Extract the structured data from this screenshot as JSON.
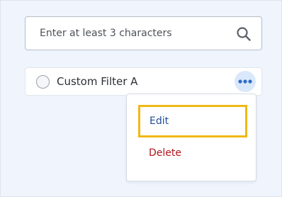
{
  "search": {
    "placeholder": "Enter at least 3 characters",
    "icon": "search-icon"
  },
  "filter": {
    "label": "Custom Filter A",
    "selected": false,
    "more_icon": "more-horizontal-icon"
  },
  "menu": {
    "items": [
      {
        "label": "Edit",
        "color": "#1f4e9a",
        "focused": true
      },
      {
        "label": "Delete",
        "color": "#b4141c",
        "focused": false
      }
    ]
  },
  "colors": {
    "background": "#eff4fd",
    "focus_outline": "#efb913",
    "more_button_bg": "#d9e8fb",
    "more_dots": "#2f6cc8"
  }
}
